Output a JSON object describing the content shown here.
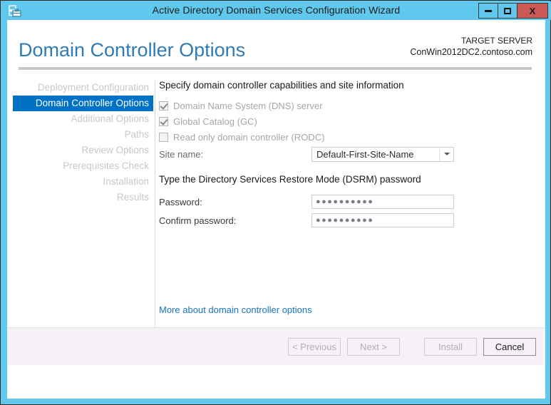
{
  "window": {
    "title": "Active Directory Domain Services Configuration Wizard",
    "icon": "server-wizard-icon",
    "controls": {
      "minimize": "minimize-icon",
      "maximize": "maximize-icon",
      "close": "X"
    },
    "frame_color": "#5fc8ec",
    "close_color": "#cb5a55"
  },
  "header": {
    "page_title": "Domain Controller Options",
    "target_label": "TARGET SERVER",
    "target_server": "ConWin2012DC2.contoso.com",
    "title_color": "#2e7bb5"
  },
  "sidebar": {
    "selected_color": "#0072c6",
    "items": [
      {
        "label": "Deployment Configuration",
        "selected": false
      },
      {
        "label": "Domain Controller Options",
        "selected": true
      },
      {
        "label": "Additional Options",
        "selected": false
      },
      {
        "label": "Paths",
        "selected": false
      },
      {
        "label": "Review Options",
        "selected": false
      },
      {
        "label": "Prerequisites Check",
        "selected": false
      },
      {
        "label": "Installation",
        "selected": false
      },
      {
        "label": "Results",
        "selected": false
      }
    ]
  },
  "main": {
    "capabilities_heading": "Specify domain controller capabilities and site information",
    "checkboxes": [
      {
        "label": "Domain Name System (DNS) server",
        "checked": true,
        "enabled": false
      },
      {
        "label": "Global Catalog (GC)",
        "checked": true,
        "enabled": false
      },
      {
        "label": "Read only domain controller (RODC)",
        "checked": false,
        "enabled": false
      }
    ],
    "site_name_label": "Site name:",
    "site_name_value": "Default-First-Site-Name",
    "dsrm_heading": "Type the Directory Services Restore Mode (DSRM) password",
    "password_label": "Password:",
    "password_value": "●●●●●●●●●●",
    "confirm_label": "Confirm password:",
    "confirm_value": "●●●●●●●●●●",
    "more_link": "More about domain controller options",
    "link_color": "#1674c0"
  },
  "footer": {
    "buttons": [
      {
        "label": "< Previous",
        "enabled": false
      },
      {
        "label": "Next >",
        "enabled": false
      },
      {
        "label": "Install",
        "enabled": false
      },
      {
        "label": "Cancel",
        "enabled": true
      }
    ]
  }
}
